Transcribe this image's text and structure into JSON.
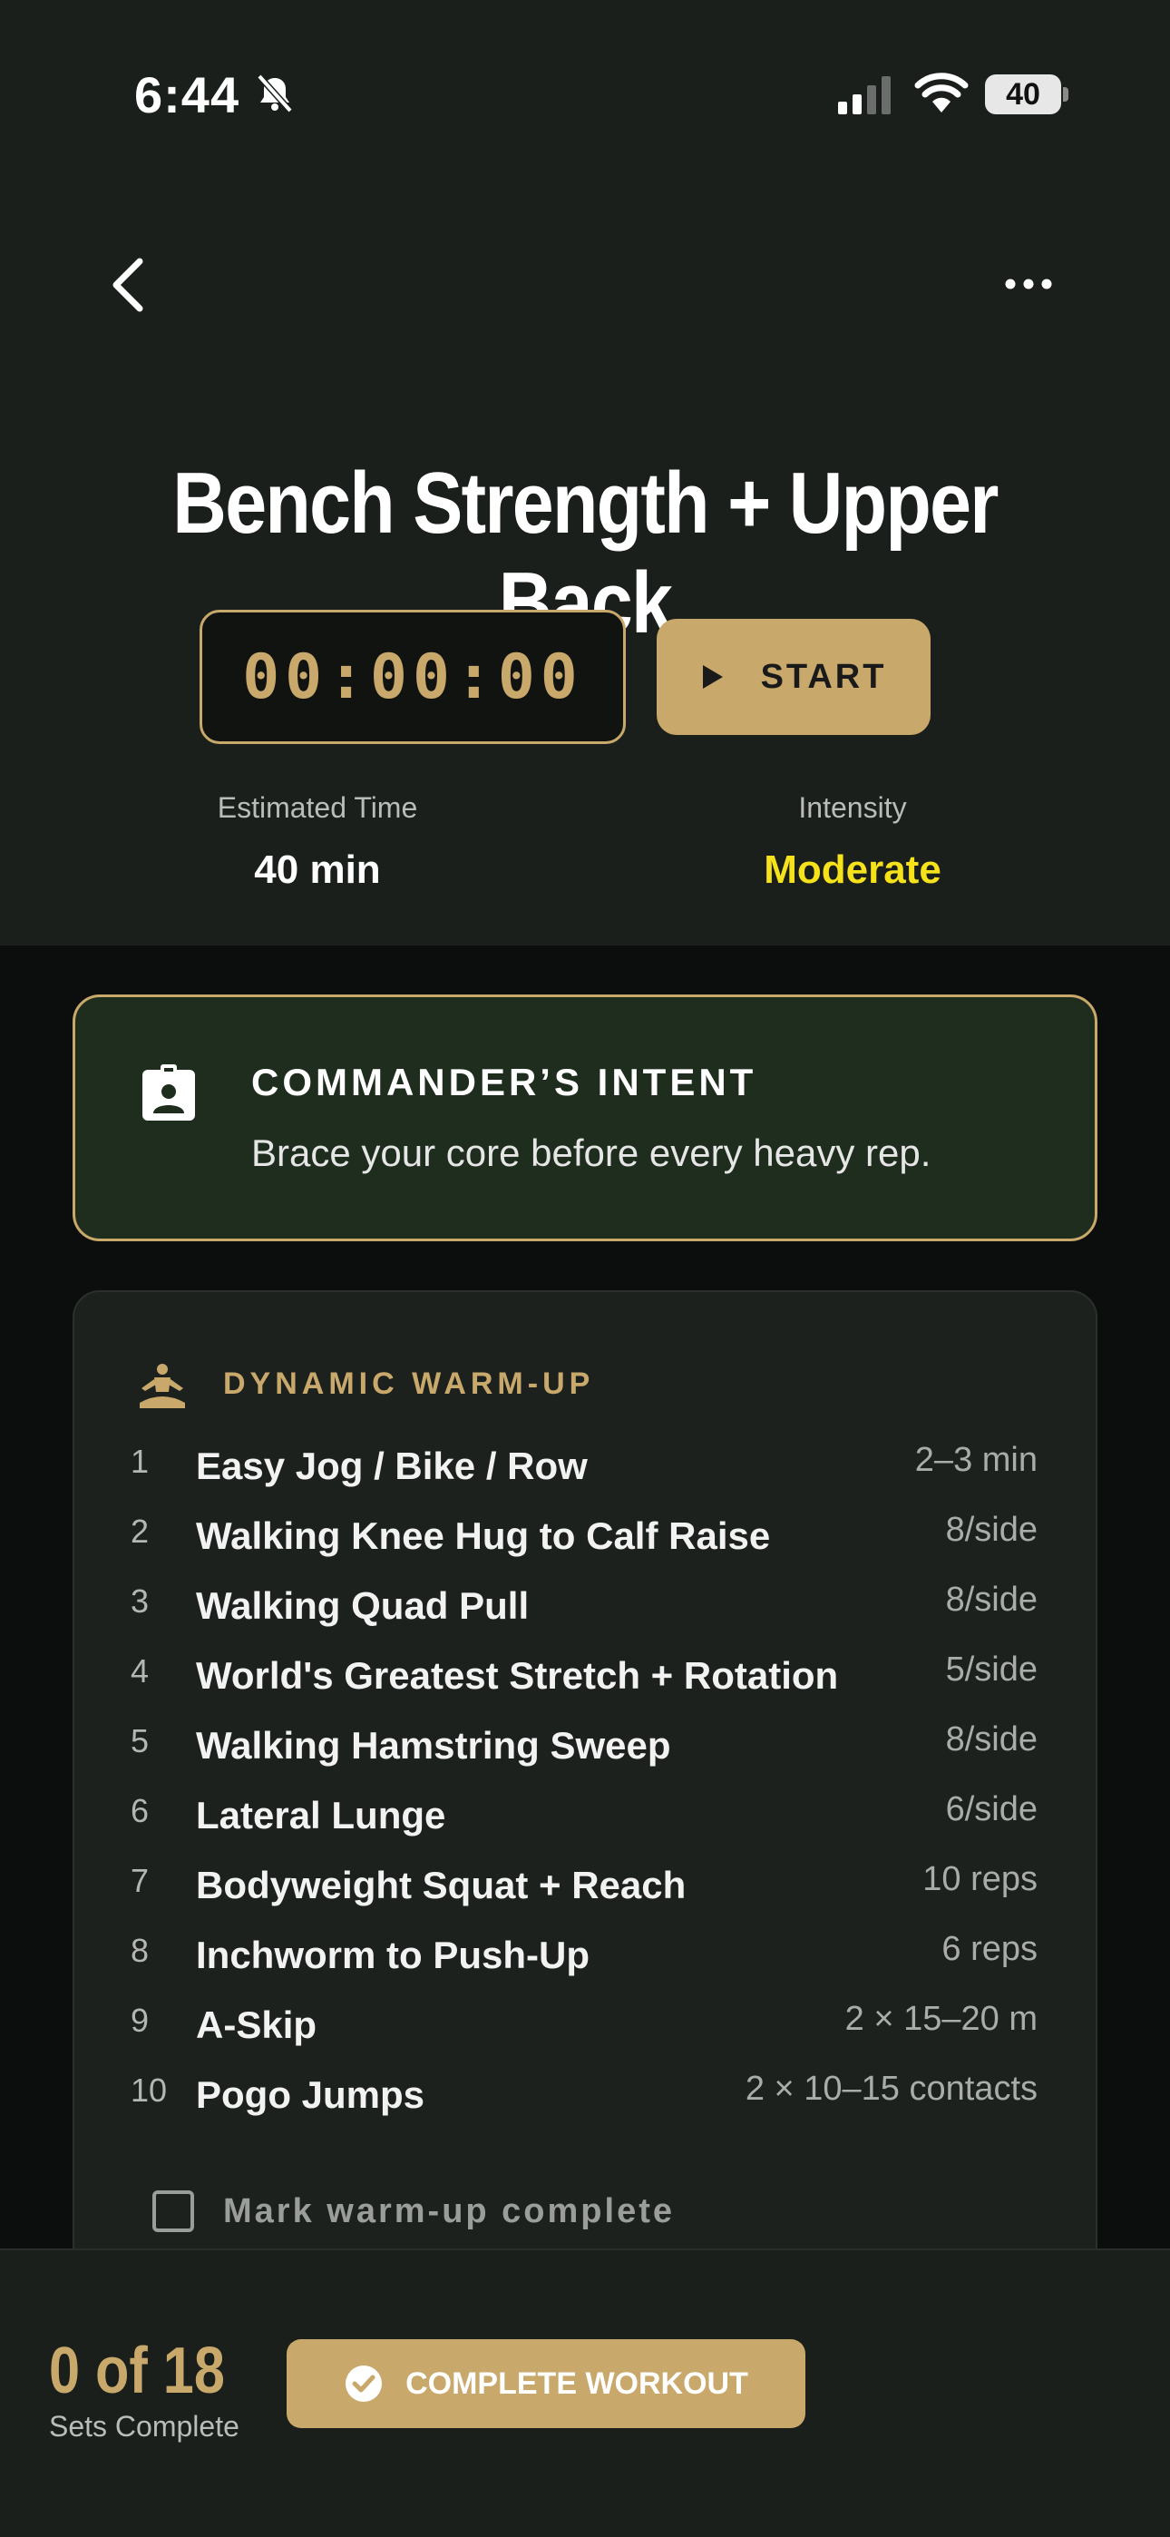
{
  "status_bar": {
    "time": "6:44",
    "battery": "40"
  },
  "header": {
    "title": "Bench Strength + Upper Back"
  },
  "timer": {
    "display": "00:00:00",
    "start_label": "START"
  },
  "meta": {
    "time_label": "Estimated Time",
    "time_value": "40 min",
    "intensity_label": "Intensity",
    "intensity_value": "Moderate"
  },
  "intent": {
    "title": "COMMANDER’S INTENT",
    "text": "Brace your core before every heavy rep."
  },
  "warmup": {
    "title": "DYNAMIC WARM-UP",
    "items": [
      {
        "num": "1",
        "name": "Easy Jog / Bike / Row",
        "dose": "2–3 min"
      },
      {
        "num": "2",
        "name": "Walking Knee Hug to Calf Raise",
        "dose": "8/side"
      },
      {
        "num": "3",
        "name": "Walking Quad Pull",
        "dose": "8/side"
      },
      {
        "num": "4",
        "name": "World's Greatest Stretch + Rotation",
        "dose": "5/side"
      },
      {
        "num": "5",
        "name": "Walking Hamstring Sweep",
        "dose": "8/side"
      },
      {
        "num": "6",
        "name": "Lateral Lunge",
        "dose": "6/side"
      },
      {
        "num": "7",
        "name": "Bodyweight Squat + Reach",
        "dose": "10 reps"
      },
      {
        "num": "8",
        "name": "Inchworm to Push-Up",
        "dose": "6 reps"
      },
      {
        "num": "9",
        "name": "A-Skip",
        "dose": "2 × 15–20 m"
      },
      {
        "num": "10",
        "name": "Pogo Jumps",
        "dose": "2 × 10–15 contacts"
      }
    ],
    "mark_label": "Mark warm-up complete"
  },
  "footer": {
    "sets_count": "0 of 18",
    "sets_label": "Sets Complete",
    "complete_label": "COMPLETE WORKOUT"
  },
  "colors": {
    "accent": "#c8a96b",
    "intensity": "#f5e21a",
    "intent_bg": "#1e2d1e",
    "background": "#1b1f1c"
  },
  "icons": {
    "back": "chevron-left-icon",
    "more": "ellipsis-icon",
    "silent": "bell-slash-icon",
    "play": "play-icon",
    "intent": "id-badge-icon",
    "warmup": "meditation-icon",
    "complete": "check-circle-icon"
  }
}
